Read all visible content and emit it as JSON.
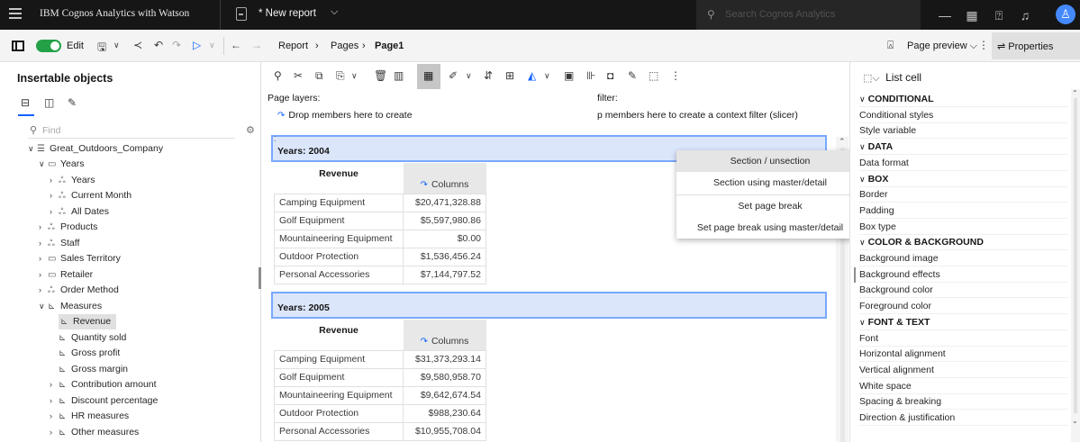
{
  "topbar": {
    "app_name": "IBM Cognos Analytics with Watson",
    "report_name": "* New report",
    "search_placeholder": "Search Cognos Analytics"
  },
  "toolbar": {
    "edit_label": "Edit",
    "breadcrumb": [
      "Report",
      "Pages",
      "Page1"
    ],
    "preview_label": "Page preview",
    "properties_label": "Properties"
  },
  "left_panel": {
    "title": "Insertable objects",
    "search_placeholder": "Find",
    "tree": [
      {
        "label": "Great_Outdoors_Company",
        "toggle": "∨",
        "icon": "☰"
      },
      {
        "label": "Years",
        "toggle": "∨",
        "icon": "▭"
      },
      {
        "label": "Years",
        "toggle": "›",
        "icon": "ஃ"
      },
      {
        "label": "Current Month",
        "toggle": "›",
        "icon": "ஃ"
      },
      {
        "label": "All Dates",
        "toggle": "›",
        "icon": "ஃ"
      },
      {
        "label": "Products",
        "toggle": "›",
        "icon": "ஃ"
      },
      {
        "label": "Staff",
        "toggle": "›",
        "icon": "ஃ"
      },
      {
        "label": "Sales Territory",
        "toggle": "›",
        "icon": "▭"
      },
      {
        "label": "Retailer",
        "toggle": "›",
        "icon": "▭"
      },
      {
        "label": "Order Method",
        "toggle": "›",
        "icon": "ஃ"
      },
      {
        "label": "Measures",
        "toggle": "∨",
        "icon": "⊾"
      },
      {
        "label": "Revenue",
        "toggle": "",
        "icon": "⊾"
      },
      {
        "label": "Quantity sold",
        "toggle": "",
        "icon": "⊾"
      },
      {
        "label": "Gross profit",
        "toggle": "",
        "icon": "⊾"
      },
      {
        "label": "Gross margin",
        "toggle": "",
        "icon": "⊾"
      },
      {
        "label": "Contribution amount",
        "toggle": "›",
        "icon": "⊾"
      },
      {
        "label": "Discount percentage",
        "toggle": "›",
        "icon": "⊾"
      },
      {
        "label": "HR measures",
        "toggle": "›",
        "icon": "⊾"
      },
      {
        "label": "Other measures",
        "toggle": "›",
        "icon": "⊾"
      }
    ]
  },
  "canvas": {
    "page_layers_label": "Page layers:",
    "page_layers_drop": "Drop members here to create",
    "context_filter_label": "filter:",
    "context_filter_drop": "p members here to create a context filter (slicer)",
    "menu": {
      "items": [
        "Section / unsection",
        "Section using master/detail",
        "Set page break",
        "Set page break using master/detail"
      ]
    },
    "sections": [
      {
        "title": "Years: 2004",
        "header": "Revenue",
        "columns_label": "Columns",
        "rows": [
          {
            "label": "Camping Equipment",
            "value": "$20,471,328.88"
          },
          {
            "label": "Golf Equipment",
            "value": "$5,597,980.86"
          },
          {
            "label": "Mountaineering Equipment",
            "value": "$0.00"
          },
          {
            "label": "Outdoor Protection",
            "value": "$1,536,456.24"
          },
          {
            "label": "Personal Accessories",
            "value": "$7,144,797.52"
          }
        ]
      },
      {
        "title": "Years: 2005",
        "header": "Revenue",
        "columns_label": "Columns",
        "rows": [
          {
            "label": "Camping Equipment",
            "value": "$31,373,293.14"
          },
          {
            "label": "Golf Equipment",
            "value": "$9,580,958.70"
          },
          {
            "label": "Mountaineering Equipment",
            "value": "$9,642,674.54"
          },
          {
            "label": "Outdoor Protection",
            "value": "$988,230.64"
          },
          {
            "label": "Personal Accessories",
            "value": "$10,955,708.04"
          }
        ]
      }
    ]
  },
  "right_panel": {
    "header": "List cell",
    "rows": [
      {
        "label": "CONDITIONAL",
        "cat": true
      },
      {
        "label": "Conditional styles",
        "cat": false
      },
      {
        "label": "Style variable",
        "cat": false
      },
      {
        "label": "DATA",
        "cat": true
      },
      {
        "label": "Data format",
        "cat": false
      },
      {
        "label": "BOX",
        "cat": true
      },
      {
        "label": "Border",
        "cat": false
      },
      {
        "label": "Padding",
        "cat": false
      },
      {
        "label": "Box type",
        "cat": false
      },
      {
        "label": "COLOR & BACKGROUND",
        "cat": true
      },
      {
        "label": "Background image",
        "cat": false
      },
      {
        "label": "Background effects",
        "cat": false
      },
      {
        "label": "Background color",
        "cat": false
      },
      {
        "label": "Foreground color",
        "cat": false
      },
      {
        "label": "FONT & TEXT",
        "cat": true
      },
      {
        "label": "Font",
        "cat": false
      },
      {
        "label": "Horizontal alignment",
        "cat": false
      },
      {
        "label": "Vertical alignment",
        "cat": false
      },
      {
        "label": "White space",
        "cat": false
      },
      {
        "label": "Spacing & breaking",
        "cat": false
      },
      {
        "label": "Direction & justification",
        "cat": false
      }
    ]
  },
  "colors": {
    "accent": "#0f62fe",
    "toggle_on": "#24a148",
    "section_bg": "#dbe6fb",
    "section_border": "#78a9ff",
    "topbar_bg": "#161616"
  }
}
